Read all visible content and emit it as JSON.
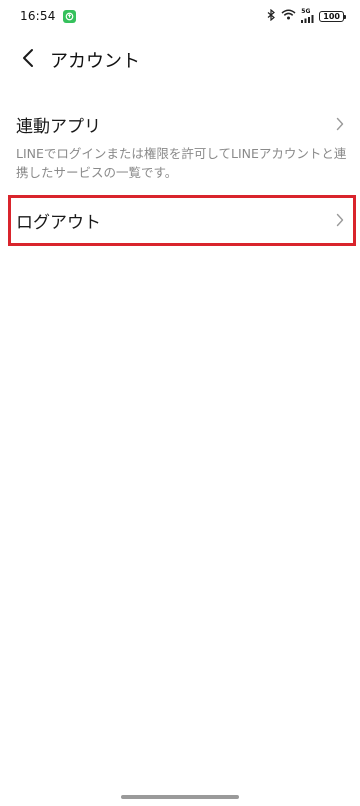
{
  "status_bar": {
    "time": "16:54",
    "network_label": "5G",
    "battery_level": "100"
  },
  "header": {
    "title": "アカウント",
    "back_icon": "chevron-left-icon"
  },
  "linked_apps": {
    "label": "連動アプリ",
    "description": "LINEでログインまたは権限を許可してLINEアカウントと連携したサービスの一覧です。"
  },
  "logout": {
    "label": "ログアウト"
  },
  "colors": {
    "highlight": "#d9242c",
    "notification": "#35c15c",
    "description_text": "#8a8a8a"
  }
}
